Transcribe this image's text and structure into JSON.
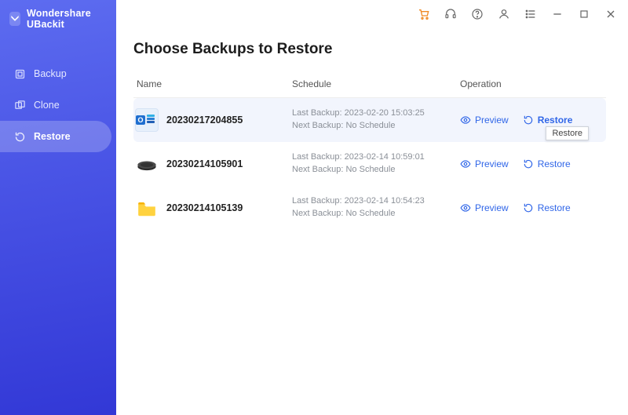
{
  "brand": {
    "name": "Wondershare UBackit"
  },
  "sidebar": {
    "items": [
      {
        "label": "Backup"
      },
      {
        "label": "Clone"
      },
      {
        "label": "Restore"
      }
    ]
  },
  "page": {
    "title": "Choose Backups to Restore"
  },
  "table": {
    "headers": {
      "name": "Name",
      "schedule": "Schedule",
      "operation": "Operation"
    },
    "schedule_label": {
      "last": "Last Backup:",
      "next": "Next Backup:"
    },
    "op_labels": {
      "preview": "Preview",
      "restore": "Restore"
    },
    "rows": [
      {
        "name": "20230217204855",
        "last": "2023-02-20 15:03:25",
        "next": "No Schedule"
      },
      {
        "name": "20230214105901",
        "last": "2023-02-14 10:59:01",
        "next": "No Schedule"
      },
      {
        "name": "20230214105139",
        "last": "2023-02-14 10:54:23",
        "next": "No Schedule"
      }
    ]
  },
  "tooltip": {
    "restore": "Restore"
  }
}
